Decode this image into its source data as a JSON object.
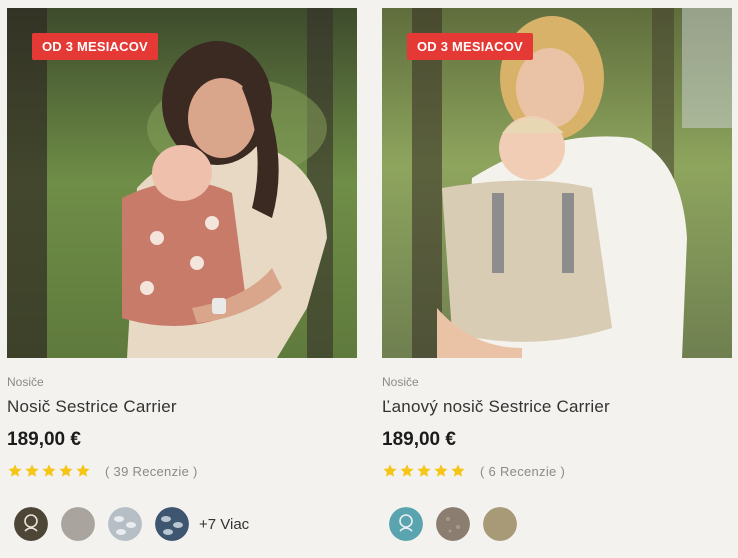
{
  "products": [
    {
      "badge": "OD 3 MESIACOV",
      "category": "Nosiče",
      "title": "Nosič Sestrice Carrier",
      "price": "189,00 €",
      "rating": 5,
      "reviews": "( 39 Recenzie )",
      "swatch_colors": [
        "#4d4536",
        "#a9a49d",
        "#b7bfc6",
        "#3f5670"
      ],
      "more_label": "+7 Viac"
    },
    {
      "badge": "OD 3 MESIACOV",
      "category": "Nosiče",
      "title": "Ľanový nosič Sestrice Carrier",
      "price": "189,00 €",
      "rating": 5,
      "reviews": "( 6 Recenzie )",
      "swatch_colors": [
        "#5aa4b0",
        "#8b7e70",
        "#a99a77"
      ]
    }
  ],
  "colors": {
    "badge": "#e53935",
    "star": "#f5c518"
  }
}
